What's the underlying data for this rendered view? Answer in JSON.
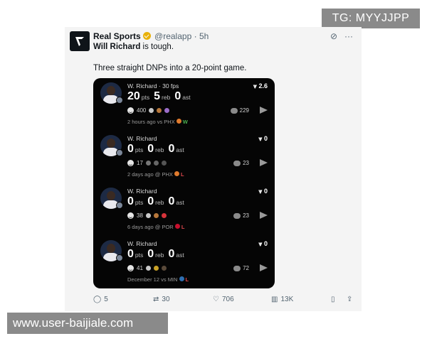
{
  "watermarks": {
    "top": "TG: MYYJJPP",
    "bottom": "www.user-baijiale.com"
  },
  "post": {
    "author_name": "Real Sports",
    "handle": "@realapp",
    "separator": "·",
    "time": "5h",
    "headline_bold": "Will Richard",
    "headline_rest": " is tough.",
    "body": "Three straight DNPs into a 20-point game.",
    "icons": [
      "grok-icon",
      "more-icon"
    ]
  },
  "card": {
    "rows": [
      {
        "name": "W. Richard · 30 fps",
        "pts": "20",
        "reb": "5",
        "ast": "0",
        "pts_label": "pts",
        "reb_label": "reb",
        "ast_label": "ast",
        "score": "2.6",
        "reactions": "400",
        "comments": "229",
        "ago": "2 hours ago vs PHX",
        "result": "W",
        "result_type": "win"
      },
      {
        "name": "W. Richard",
        "pts": "0",
        "reb": "0",
        "ast": "0",
        "pts_label": "pts",
        "reb_label": "reb",
        "ast_label": "ast",
        "score": "0",
        "reactions": "17",
        "comments": "23",
        "ago": "2 days ago @ PHX",
        "result": "L",
        "result_type": "loss"
      },
      {
        "name": "W. Richard",
        "pts": "0",
        "reb": "0",
        "ast": "0",
        "pts_label": "pts",
        "reb_label": "reb",
        "ast_label": "ast",
        "score": "0",
        "reactions": "38",
        "comments": "23",
        "ago": "6 days ago @ POR",
        "result": "L",
        "result_type": "loss"
      },
      {
        "name": "W. Richard",
        "pts": "0",
        "reb": "0",
        "ast": "0",
        "pts_label": "pts",
        "reb_label": "reb",
        "ast_label": "ast",
        "score": "0",
        "reactions": "41",
        "comments": "72",
        "ago": "December 12 vs MIN",
        "result": "L",
        "result_type": "loss"
      }
    ]
  },
  "actions": {
    "replies": "5",
    "reposts": "30",
    "likes": "706",
    "views": "13K"
  },
  "colors": {
    "card_bg": "#050505",
    "win": "#4bb04f",
    "loss": "#e0474c",
    "verified": "#e8b10a"
  }
}
